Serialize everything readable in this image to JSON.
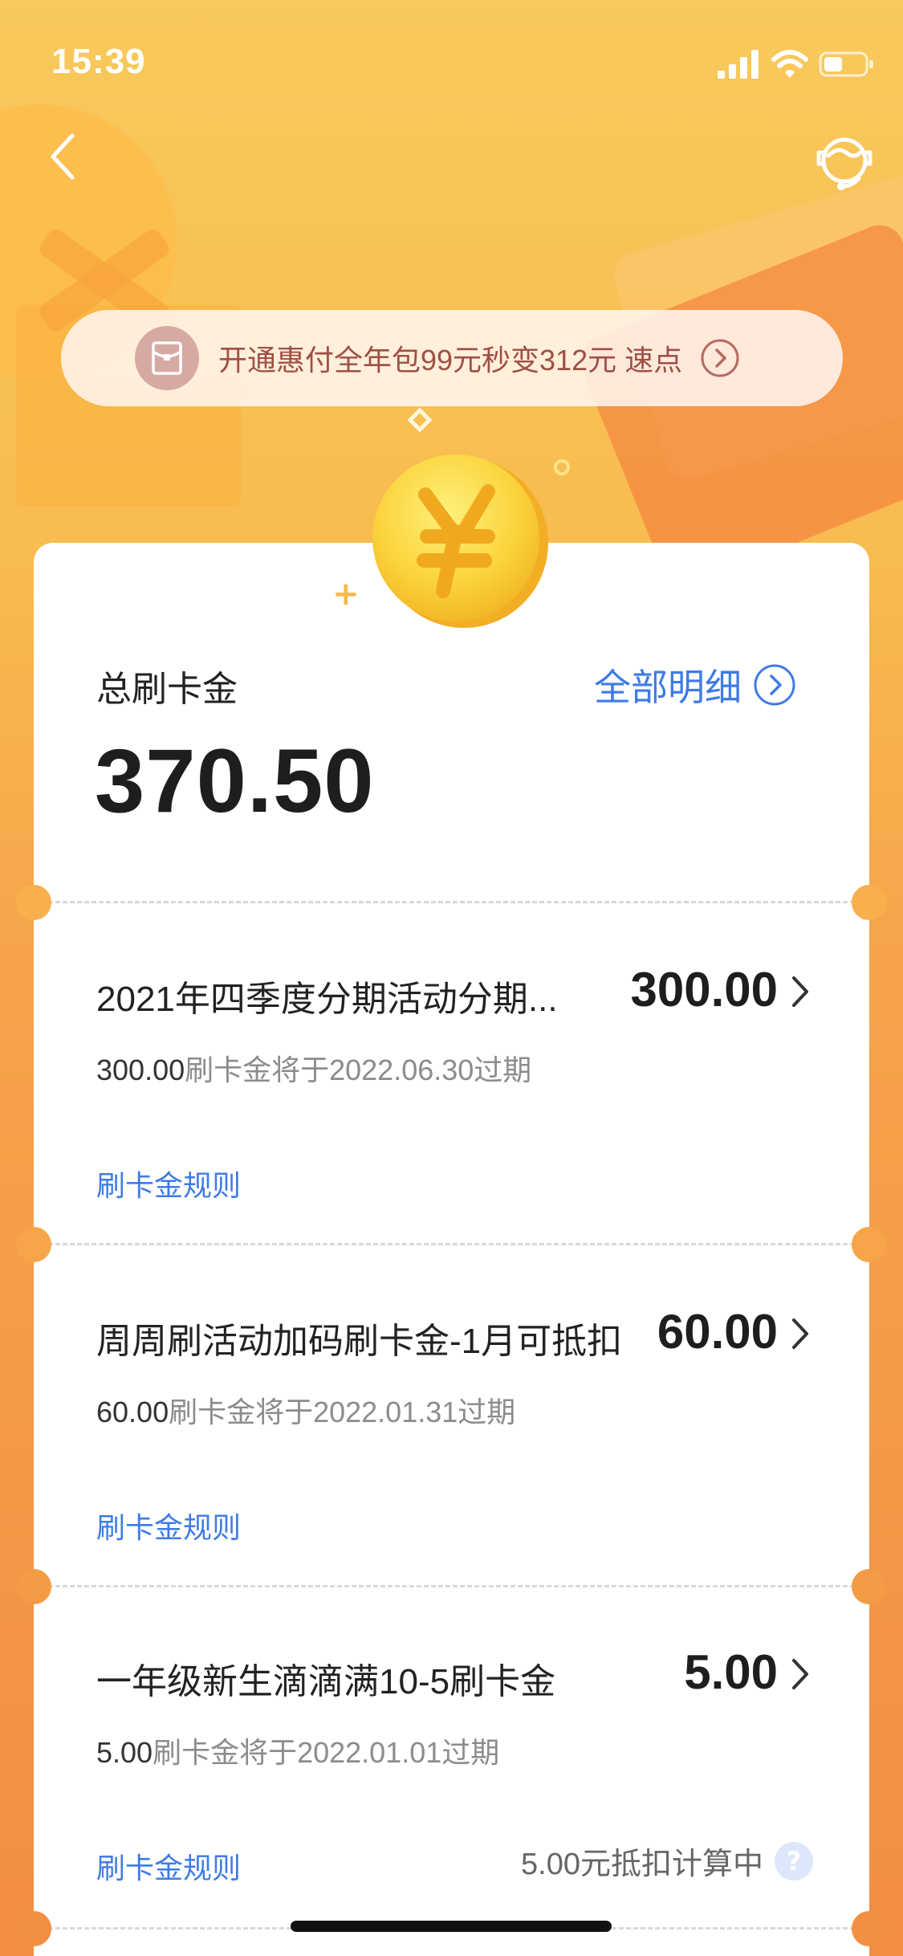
{
  "status_bar": {
    "time": "15:39",
    "icons": [
      "signal-icon",
      "wifi-icon",
      "battery-icon"
    ]
  },
  "nav": {
    "back_icon": "chevron-left-icon",
    "service_icon": "customer-service-icon"
  },
  "promo": {
    "icon": "red-envelope-icon",
    "text": "开通惠付全年包99元秒变312元  速点",
    "arrow_icon": "circle-arrow-right-icon"
  },
  "summary": {
    "label": "总刷卡金",
    "amount": "370.50",
    "all_details_label": "全部明细"
  },
  "items": [
    {
      "title": "2021年四季度分期活动分期...",
      "amount": "300.00",
      "expire_amount": "300.00",
      "expire_text": "刷卡金将于2022.06.30过期",
      "rule_label": "刷卡金规则"
    },
    {
      "title": "周周刷活动加码刷卡金-1月可抵扣",
      "amount": "60.00",
      "expire_amount": "60.00",
      "expire_text": "刷卡金将于2022.01.31过期",
      "rule_label": "刷卡金规则"
    },
    {
      "title": "一年级新生滴滴满10-5刷卡金",
      "amount": "5.00",
      "expire_amount": "5.00",
      "expire_text": "刷卡金将于2022.01.01过期",
      "rule_label": "刷卡金规则",
      "deduct_text": "5.00元抵扣计算中",
      "help_symbol": "?"
    }
  ],
  "colors": {
    "accent_blue": "#3f7be6",
    "background_top": "#f8c95c",
    "background_bottom": "#f38d42",
    "promo_text": "#9f4f45"
  }
}
